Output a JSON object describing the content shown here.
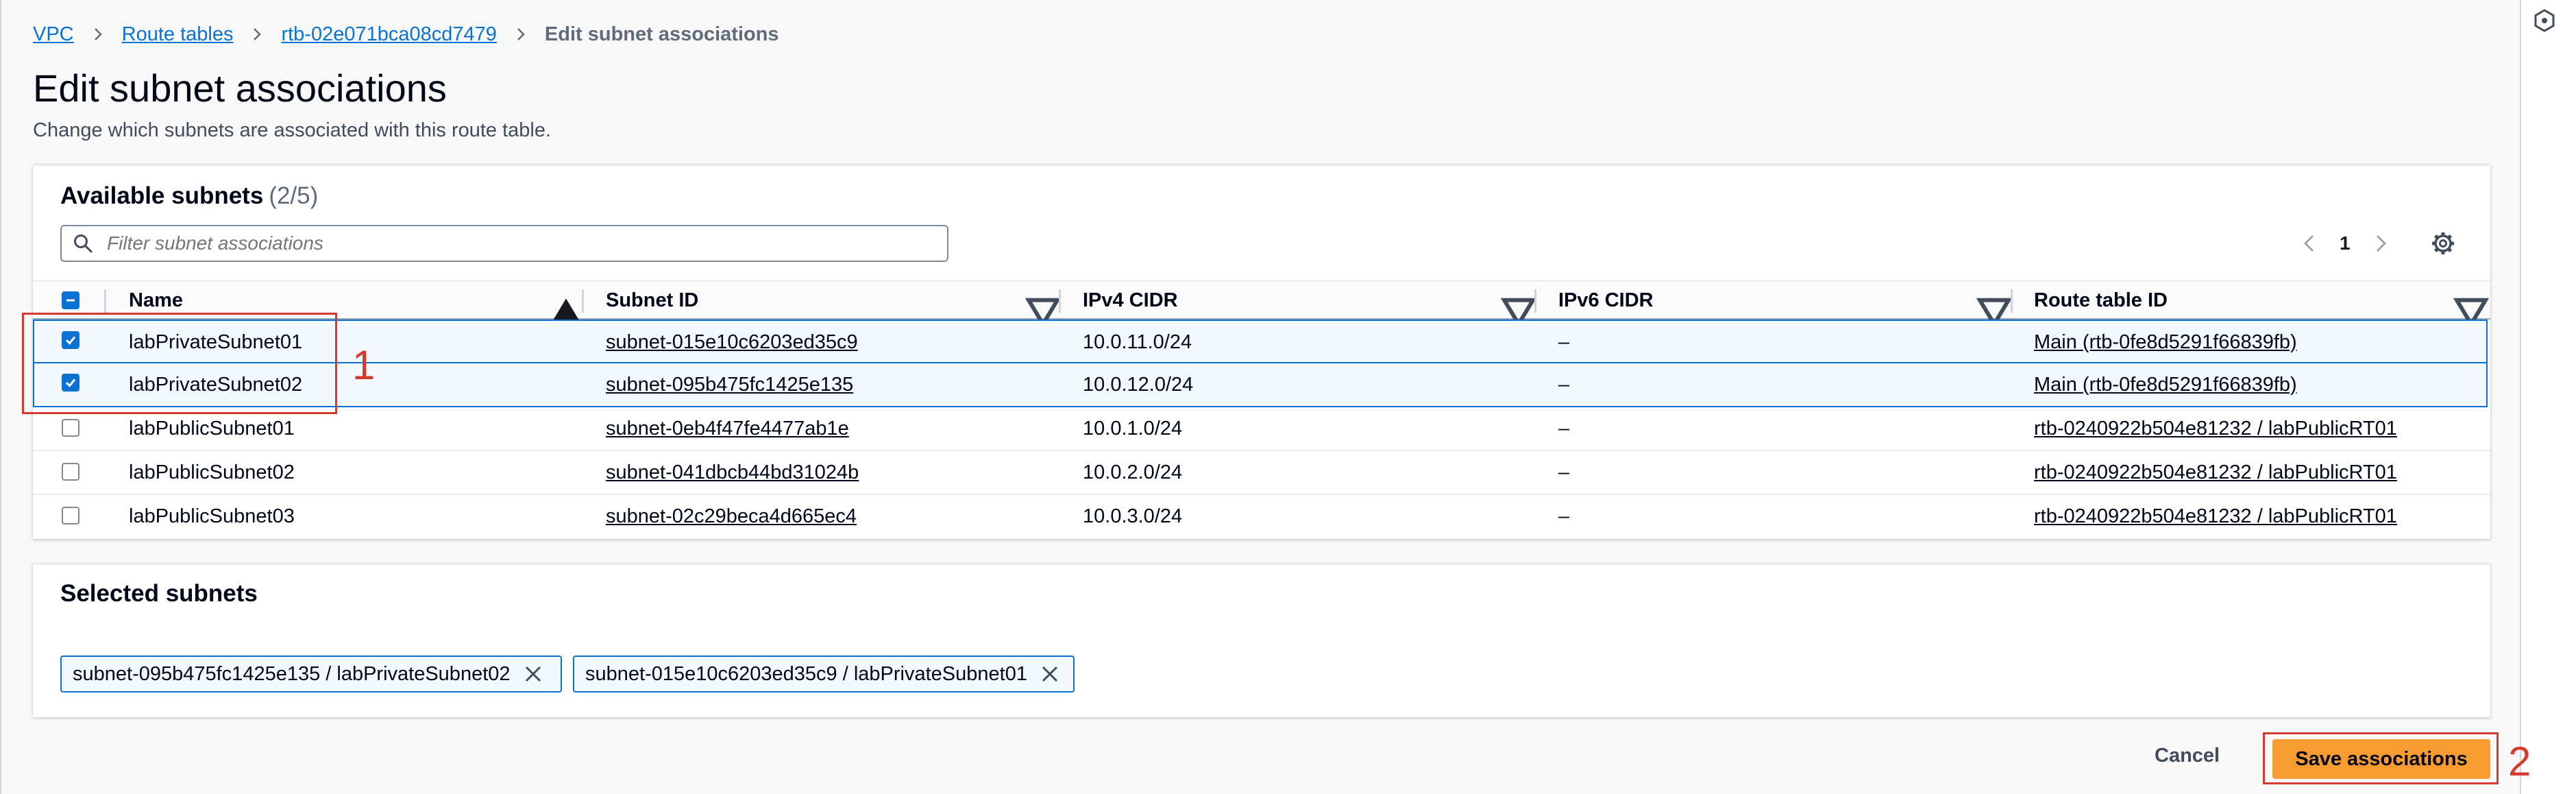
{
  "breadcrumb": {
    "items": [
      "VPC",
      "Route tables",
      "rtb-02e071bca08cd7479"
    ],
    "current": "Edit subnet associations"
  },
  "page": {
    "title": "Edit subnet associations",
    "description": "Change which subnets are associated with this route table."
  },
  "available": {
    "heading": "Available subnets",
    "count": "(2/5)",
    "filter_placeholder": "Filter subnet associations",
    "page_number": "1",
    "columns": [
      "Name",
      "Subnet ID",
      "IPv4 CIDR",
      "IPv6 CIDR",
      "Route table ID"
    ],
    "rows": [
      {
        "checked": true,
        "name": "labPrivateSubnet01",
        "subnet_id": "subnet-015e10c6203ed35c9",
        "ipv4": "10.0.11.0/24",
        "ipv6": "–",
        "route_table": "Main (rtb-0fe8d5291f66839fb)"
      },
      {
        "checked": true,
        "name": "labPrivateSubnet02",
        "subnet_id": "subnet-095b475fc1425e135",
        "ipv4": "10.0.12.0/24",
        "ipv6": "–",
        "route_table": "Main (rtb-0fe8d5291f66839fb)"
      },
      {
        "checked": false,
        "name": "labPublicSubnet01",
        "subnet_id": "subnet-0eb4f47fe4477ab1e",
        "ipv4": "10.0.1.0/24",
        "ipv6": "–",
        "route_table": "rtb-0240922b504e81232 / labPublicRT01"
      },
      {
        "checked": false,
        "name": "labPublicSubnet02",
        "subnet_id": "subnet-041dbcb44bd31024b",
        "ipv4": "10.0.2.0/24",
        "ipv6": "–",
        "route_table": "rtb-0240922b504e81232 / labPublicRT01"
      },
      {
        "checked": false,
        "name": "labPublicSubnet03",
        "subnet_id": "subnet-02c29beca4d665ec4",
        "ipv4": "10.0.3.0/24",
        "ipv6": "–",
        "route_table": "rtb-0240922b504e81232 / labPublicRT01"
      }
    ]
  },
  "selected": {
    "heading": "Selected subnets",
    "tokens": [
      "subnet-095b475fc1425e135 / labPrivateSubnet02",
      "subnet-015e10c6203ed35c9 / labPrivateSubnet01"
    ]
  },
  "footer": {
    "cancel_label": "Cancel",
    "save_label": "Save associations"
  },
  "annotations": {
    "step1": "1",
    "step2": "2"
  },
  "colors": {
    "link": "#0972d3",
    "primary_button": "#f89c31",
    "annotation": "#d23b2e"
  }
}
